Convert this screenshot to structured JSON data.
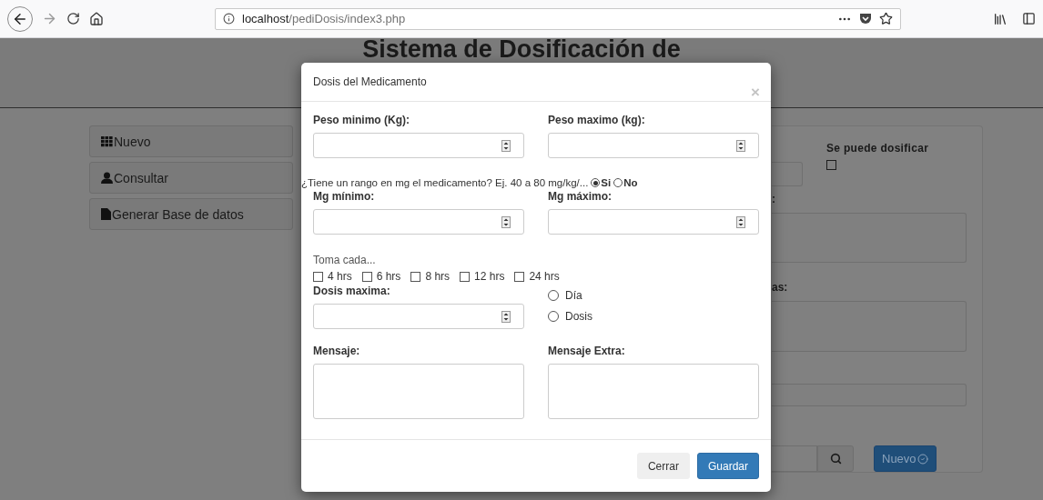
{
  "browser": {
    "url_host": "localhost",
    "url_path": "/pediDosis/index3.php"
  },
  "page": {
    "title": "Sistema de Dosificación de",
    "menu": [
      {
        "label": "Nuevo",
        "kind": "grid"
      },
      {
        "label": "Consultar",
        "kind": "user"
      },
      {
        "label": "Generar Base de datos",
        "kind": "file"
      }
    ],
    "panel": {
      "dosify_label": "Se puede dosificar",
      "dosify_checked": false,
      "label_1": ":",
      "label_2": "as:",
      "new_button": "Nuevo"
    }
  },
  "modal": {
    "title": "Dosis del Medicamento",
    "close": "×",
    "weight_min_label": "Peso minimo (Kg):",
    "weight_max_label": "Peso maximo (kg):",
    "range_question": "¿Tiene un rango en mg el medicamento? Ej. 40 a 80 mg/kg/...",
    "range_options": [
      {
        "label": "Si",
        "selected": true
      },
      {
        "label": "No",
        "selected": false
      }
    ],
    "mg_min_label": "Mg mínimo:",
    "mg_max_label": "Mg máximo:",
    "interval_label": "Toma cada...",
    "intervals": [
      {
        "label": "4 hrs",
        "checked": false
      },
      {
        "label": "6 hrs",
        "checked": false
      },
      {
        "label": "8 hrs",
        "checked": false
      },
      {
        "label": "12 hrs",
        "checked": false
      },
      {
        "label": "24 hrs",
        "checked": false
      }
    ],
    "max_dose_label": "Dosis maxima:",
    "max_dose_units": [
      {
        "label": "Día",
        "selected": false
      },
      {
        "label": "Dosis",
        "selected": false
      }
    ],
    "message_label": "Mensaje:",
    "extra_message_label": "Mensaje Extra:",
    "buttons": [
      {
        "label": "Cerrar",
        "kind": "default"
      },
      {
        "label": "Guardar",
        "kind": "primary"
      }
    ]
  }
}
